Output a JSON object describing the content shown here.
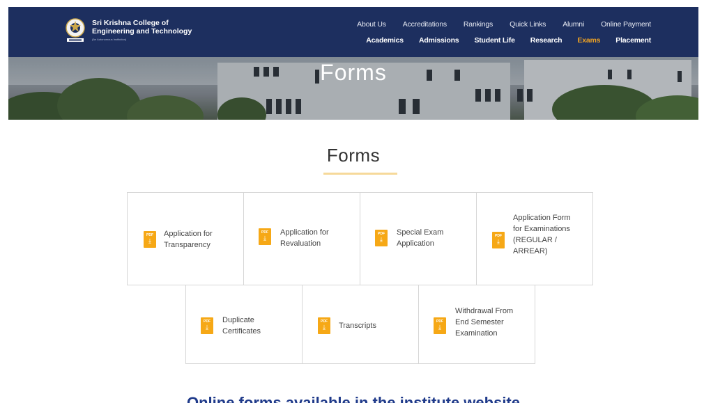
{
  "header": {
    "college_line1": "Sri Krishna College of",
    "college_line2": "Engineering and Technology",
    "college_tagline": "(An Autonomous Institution)",
    "nav_top": [
      "About Us",
      "Accreditations",
      "Rankings",
      "Quick Links",
      "Alumni",
      "Online Payment"
    ],
    "nav_main": [
      "Academics",
      "Admissions",
      "Student Life",
      "Research",
      "Exams",
      "Placement"
    ],
    "active_nav": "Exams",
    "accent_color": "#f0a323",
    "header_color": "#1d2f5f"
  },
  "banner": {
    "title": "Forms"
  },
  "main": {
    "title": "Forms",
    "icon": "pdf-download-icon",
    "icon_color": "#f6a816",
    "cards": [
      "Application for\nTransparency",
      "Application for\nRevaluation",
      "Special Exam\nApplication",
      "Application Form\nfor Examinations\n(REGULAR /\nARREAR)",
      "Duplicate\nCertificates",
      "Transcripts",
      "Withdrawal From\nEnd Semester\nExamination"
    ],
    "pdf_badge": "PDF",
    "bottom_text": "Online forms available in the institute website"
  }
}
